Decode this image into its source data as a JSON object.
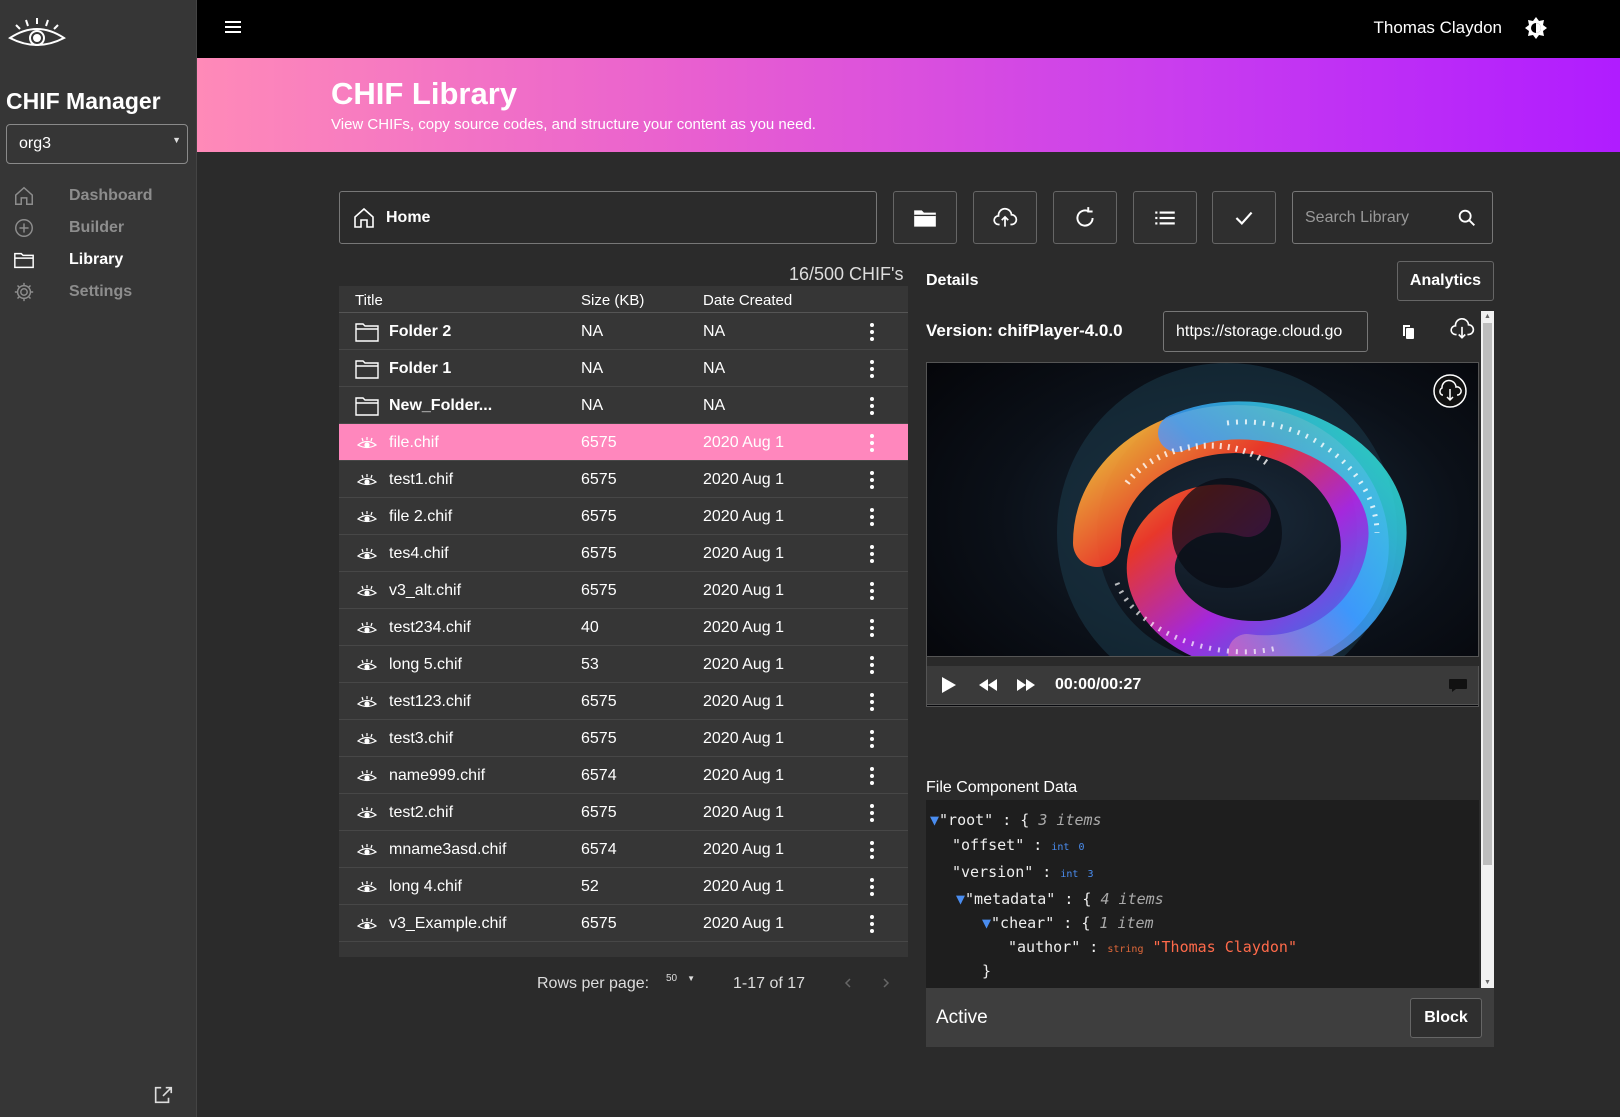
{
  "app": {
    "title": "CHIF Manager",
    "org": "org3"
  },
  "sidebar": {
    "items": [
      {
        "label": "Dashboard",
        "icon": "home-icon",
        "active": false
      },
      {
        "label": "Builder",
        "icon": "plus-circle-icon",
        "active": false
      },
      {
        "label": "Library",
        "icon": "folder-icon",
        "active": true
      },
      {
        "label": "Settings",
        "icon": "gear-icon",
        "active": false
      }
    ]
  },
  "topbar": {
    "user": "Thomas Claydon"
  },
  "banner": {
    "title": "CHIF Library",
    "subtitle": "View CHIFs, copy source codes, and structure your content as you need."
  },
  "toolbar": {
    "path": "Home",
    "search_placeholder": "Search Library"
  },
  "library": {
    "count": "16/500 CHIF's",
    "columns": [
      "Title",
      "Size (KB)",
      "Date Created"
    ],
    "rows": [
      {
        "title": "Folder 2",
        "size": "NA",
        "date": "NA",
        "type": "folder"
      },
      {
        "title": "Folder 1",
        "size": "NA",
        "date": "NA",
        "type": "folder"
      },
      {
        "title": "New_Folder...",
        "size": "NA",
        "date": "NA",
        "type": "folder"
      },
      {
        "title": "file.chif",
        "size": "6575",
        "date": "2020 Aug 1",
        "type": "file",
        "selected": true
      },
      {
        "title": "test1.chif",
        "size": "6575",
        "date": "2020 Aug 1",
        "type": "file"
      },
      {
        "title": "file 2.chif",
        "size": "6575",
        "date": "2020 Aug 1",
        "type": "file"
      },
      {
        "title": "tes4.chif",
        "size": "6575",
        "date": "2020 Aug 1",
        "type": "file"
      },
      {
        "title": "v3_alt.chif",
        "size": "6575",
        "date": "2020 Aug 1",
        "type": "file"
      },
      {
        "title": "test234.chif",
        "size": "40",
        "date": "2020 Aug 1",
        "type": "file"
      },
      {
        "title": "long 5.chif",
        "size": "53",
        "date": "2020 Aug 1",
        "type": "file"
      },
      {
        "title": "test123.chif",
        "size": "6575",
        "date": "2020 Aug 1",
        "type": "file"
      },
      {
        "title": "test3.chif",
        "size": "6575",
        "date": "2020 Aug 1",
        "type": "file"
      },
      {
        "title": "name999.chif",
        "size": "6574",
        "date": "2020 Aug 1",
        "type": "file"
      },
      {
        "title": "test2.chif",
        "size": "6575",
        "date": "2020 Aug 1",
        "type": "file"
      },
      {
        "title": "mname3asd.chif",
        "size": "6574",
        "date": "2020 Aug 1",
        "type": "file"
      },
      {
        "title": "long 4.chif",
        "size": "52",
        "date": "2020 Aug 1",
        "type": "file"
      },
      {
        "title": "v3_Example.chif",
        "size": "6575",
        "date": "2020 Aug 1",
        "type": "file"
      }
    ],
    "pager": {
      "rows_label": "Rows per page:",
      "rows_value": "50",
      "range": "1-17 of 17"
    }
  },
  "details": {
    "title": "Details",
    "analytics_label": "Analytics",
    "version": "Version: chifPlayer-4.0.0",
    "url": "https://storage.cloud.go",
    "time": "00:00/00:27",
    "component_title": "File Component Data",
    "json_lines": [
      {
        "key": "\"root\"",
        "meta": "3 items",
        "kind": "obj"
      },
      {
        "key": "\"offset\"",
        "type": "int",
        "value": "0",
        "kind": "int"
      },
      {
        "key": "\"version\"",
        "type": "int",
        "value": "3",
        "kind": "int"
      },
      {
        "key": "\"metadata\"",
        "meta": "4 items",
        "kind": "obj"
      },
      {
        "key": "\"chear\"",
        "meta": "1 item",
        "kind": "obj"
      },
      {
        "key": "\"author\"",
        "type": "string",
        "value": "\"Thomas Claydon\"",
        "kind": "str"
      },
      {
        "key": "}",
        "kind": "close"
      }
    ],
    "status": "Active",
    "block_label": "Block"
  },
  "colors": {
    "selected_row": "#ff87bd",
    "banner_start": "#ff8ab8",
    "banner_end": "#b01cff",
    "json_type": "#4a8df0",
    "json_string": "#ff6a4a"
  }
}
